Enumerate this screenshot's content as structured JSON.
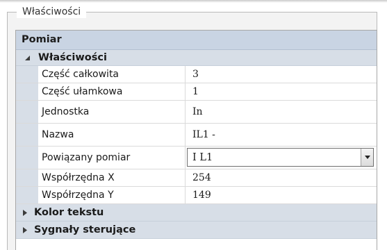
{
  "group": {
    "title": "Właściwości"
  },
  "grid": {
    "category": "Pomiar",
    "section": {
      "label": "Właściwości",
      "expanded": true
    },
    "rows": [
      {
        "name": "Część całkowita",
        "value": "3"
      },
      {
        "name": "Część ułamkowa",
        "value": "1"
      },
      {
        "name": "Jednostka",
        "value": "In"
      },
      {
        "name": "Nazwa",
        "value": "IL1 -"
      },
      {
        "name": "Powiązany pomiar",
        "value": "I L1"
      },
      {
        "name": "Współrzędna X",
        "value": "254"
      },
      {
        "name": "Współrzędna Y",
        "value": "149"
      }
    ],
    "collapsed_sections": [
      {
        "label": "Kolor tekstu"
      },
      {
        "label": "Sygnały sterujące"
      }
    ]
  },
  "icons": {
    "expanded": "expanded-triangle-icon",
    "collapsed": "collapsed-triangle-icon",
    "dropdown": "dropdown-arrow-icon"
  },
  "colors": {
    "category_bg": "#c9d4e3",
    "section_bg": "#d7dee7"
  }
}
